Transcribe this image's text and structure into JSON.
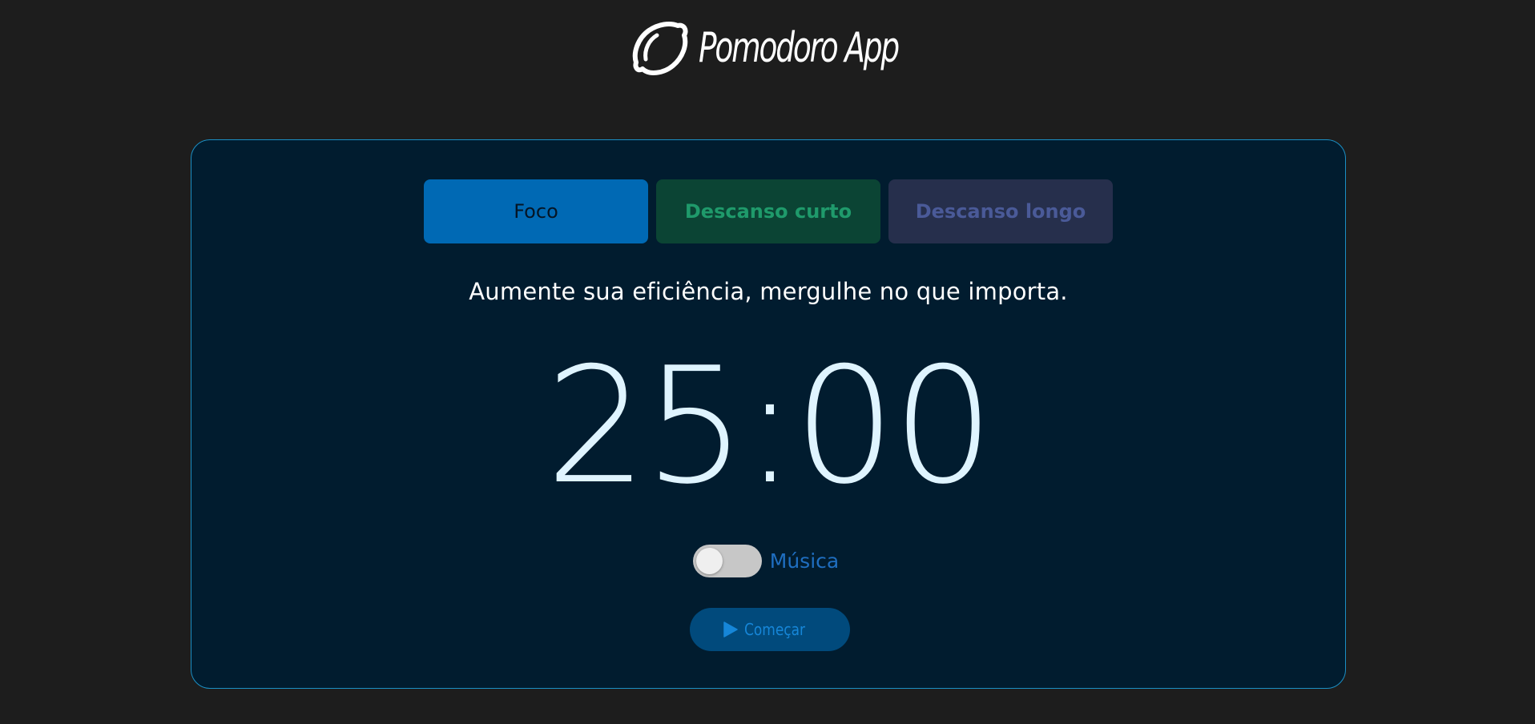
{
  "header": {
    "app_title": "Pomodoro App",
    "logo_icon": "lemon-icon"
  },
  "tabs": [
    {
      "label": "Foco",
      "active": true
    },
    {
      "label": "Descanso curto",
      "active": false
    },
    {
      "label": "Descanso longo",
      "active": false
    }
  ],
  "tagline": "Aumente sua eficiência, mergulhe no que importa.",
  "timer": {
    "display": "25:00"
  },
  "music": {
    "label": "Música",
    "enabled": false
  },
  "start_button": {
    "label": "Começar",
    "icon": "play-icon"
  },
  "colors": {
    "page_background": "#1d1d1d",
    "card_background": "#011c2f",
    "card_border": "#1b8fc4",
    "focus_tab": "#0069b4",
    "short_break_tab": "#0b4434",
    "long_break_tab": "#262f4c",
    "timer_text": "#dff4ff",
    "accent": "#1686d8"
  }
}
